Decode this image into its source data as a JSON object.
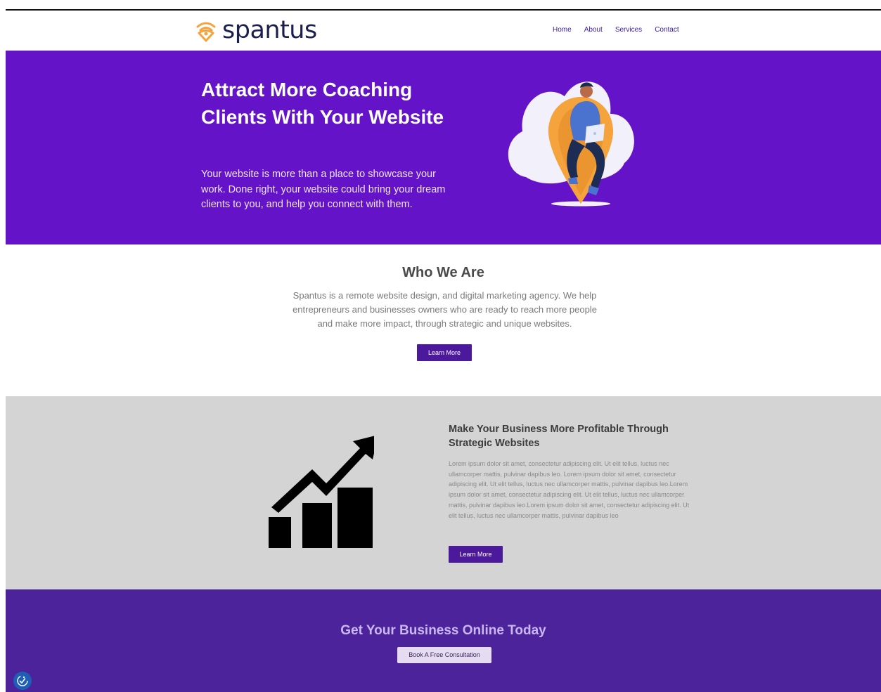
{
  "brand": {
    "name": "spantus",
    "accent": "#6413c9",
    "logo_mark_color": "#f5a33c"
  },
  "nav": {
    "items": [
      {
        "label": "Home"
      },
      {
        "label": "About"
      },
      {
        "label": "Services"
      },
      {
        "label": "Contact"
      }
    ]
  },
  "hero": {
    "title": "Attract More Coaching Clients With Your Website",
    "text": "Your website is more than a place to showcase your work. Done right, your website could bring your dream clients to you, and help you connect with them.",
    "illustration": "person-on-location-pin-illustration"
  },
  "who": {
    "title": "Who We Are",
    "text": "Spantus is a remote website design, and digital marketing agency. We help entrepreneurs and businesses owners who are ready to reach more people and make more impact, through strategic and unique websites.",
    "button": "Learn More"
  },
  "profit": {
    "title": "Make Your Business More Profitable Through Strategic Websites",
    "text": "Lorem ipsum dolor sit amet, consectetur adipiscing elit. Ut elit tellus, luctus nec ullamcorper mattis, pulvinar dapibus leo. Lorem ipsum dolor sit amet, consectetur adipiscing elit. Ut elit tellus, luctus nec ullamcorper mattis, pulvinar dapibus leo.Lorem ipsum dolor sit amet, consectetur adipiscing elit. Ut elit tellus, luctus nec ullamcorper mattis, pulvinar dapibus leo.Lorem ipsum dolor sit amet, consectetur adipiscing elit. Ut elit tellus, luctus nec ullamcorper mattis, pulvinar dapibus leo",
    "button": "Learn More",
    "icon": "growth-chart-icon"
  },
  "cta": {
    "title": "Get Your Business Online Today",
    "button": "Book A Free Consultation"
  },
  "accessibility": {
    "icon": "accessibility-icon"
  }
}
